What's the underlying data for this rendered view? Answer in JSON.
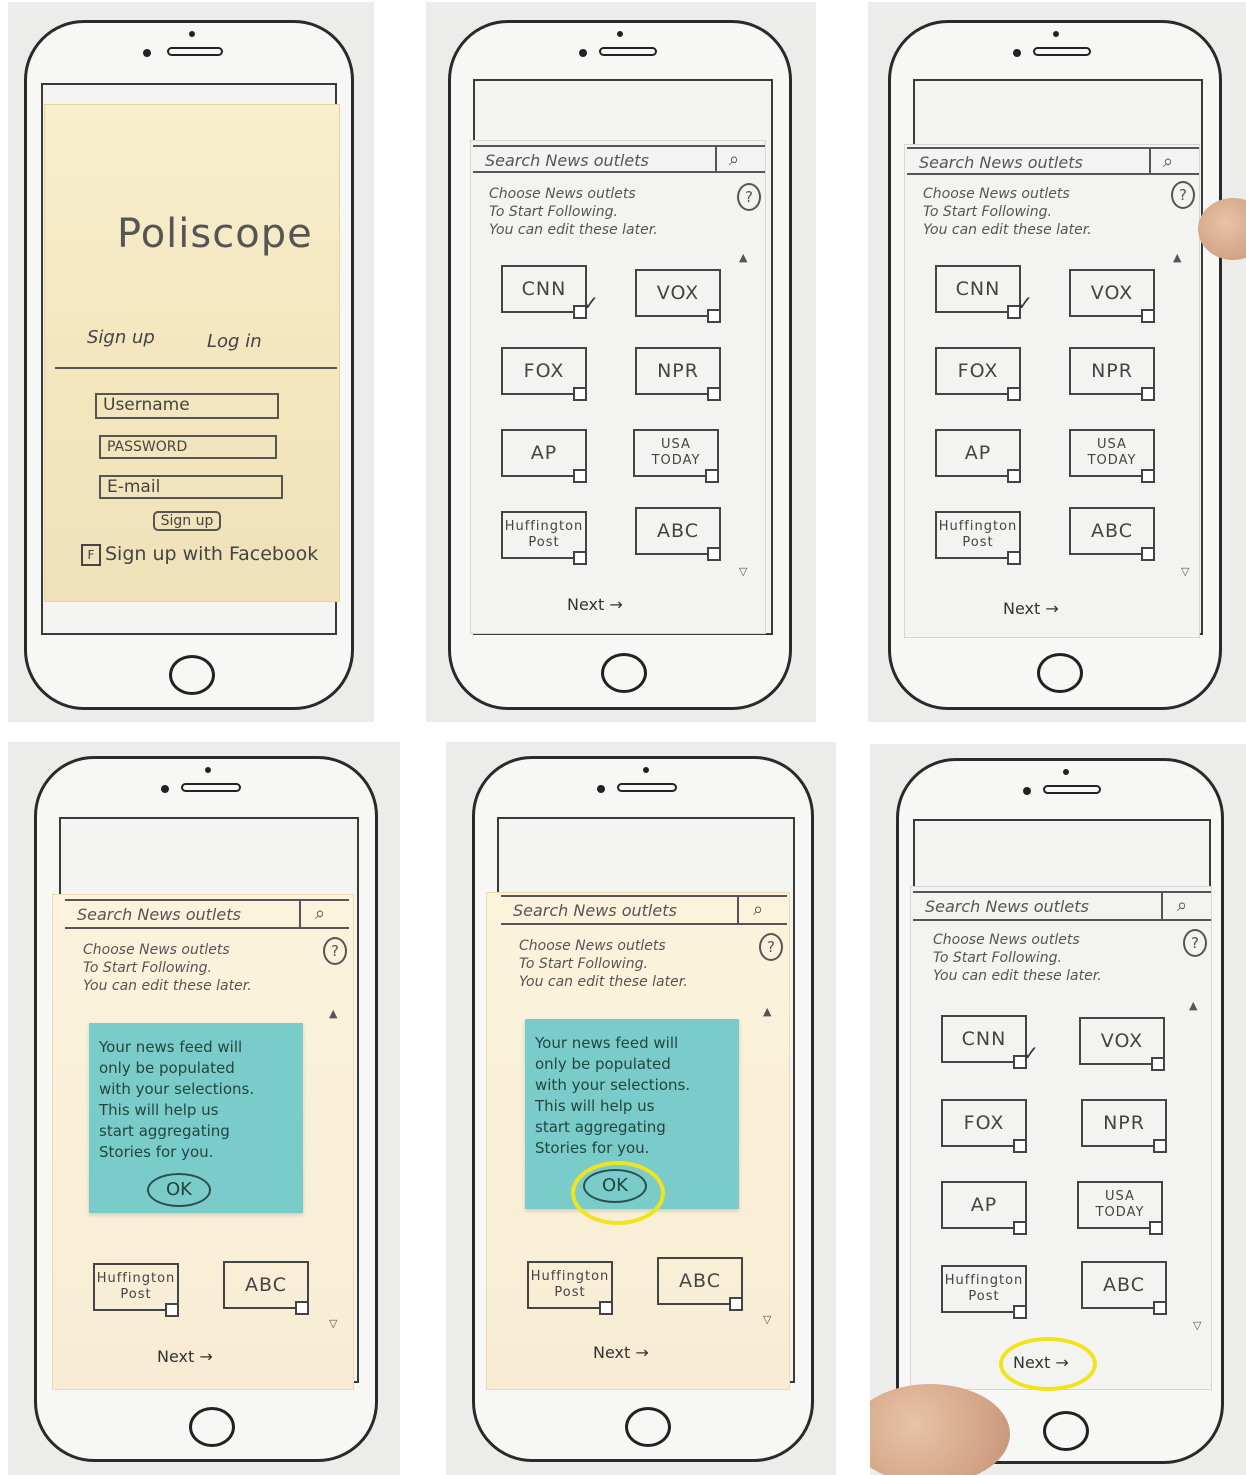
{
  "login": {
    "app_title": "Poliscope",
    "tab_signup": "Sign up",
    "tab_login": "Log in",
    "username_placeholder": "Username",
    "password_placeholder": "PASSWORD",
    "email_placeholder": "E-mail",
    "signup_button": "Sign up",
    "facebook_icon": "F",
    "facebook_label": "Sign up with Facebook"
  },
  "outlets": {
    "search_placeholder": "Search News outlets",
    "search_icon": "⌕",
    "instructions": [
      "Choose News outlets",
      "To Start Following.",
      "You can edit these later."
    ],
    "help_icon": "?",
    "scroll_up": "▲",
    "scroll_down": "▽",
    "tiles": [
      "CNN",
      "VOX",
      "FOX",
      "NPR",
      "AP",
      "USA TODAY",
      "Huffington Post",
      "ABC"
    ],
    "next_label": "Next →"
  },
  "popup": {
    "message": "Your news feed will\nonly be populated\nwith your selections.\nThis will help us\nstart aggregating\nStories for you.",
    "ok_label": "OK"
  },
  "colors": {
    "sticky_note": "#79ccc9",
    "highlight": "#f2e41c",
    "login_paper": "#f4e6bd"
  }
}
